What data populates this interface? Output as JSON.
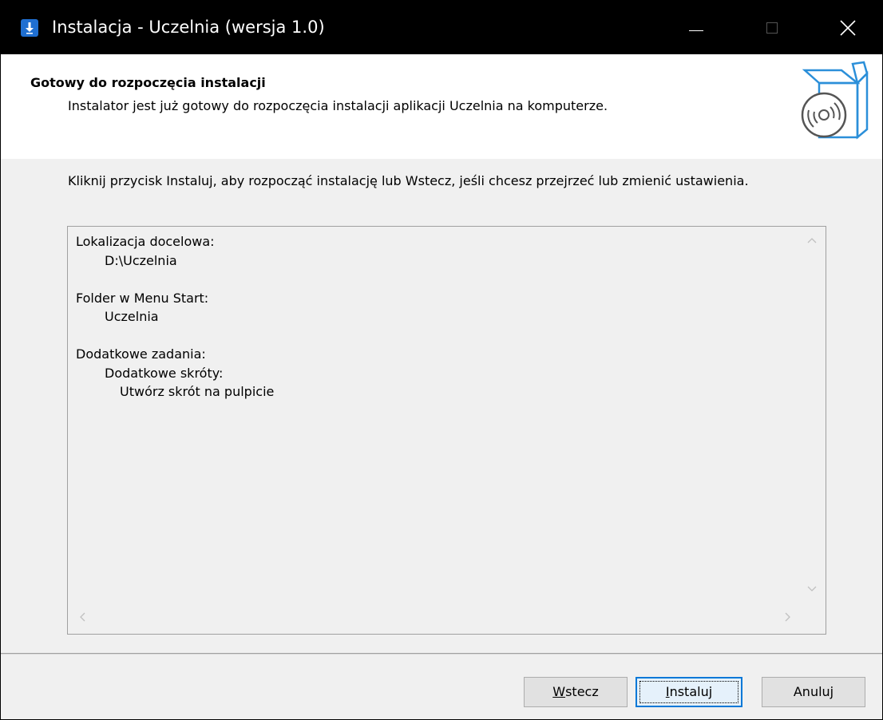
{
  "window": {
    "title": "Instalacja - Uczelnia (wersja 1.0)"
  },
  "header": {
    "title": "Gotowy do rozpoczęcia instalacji",
    "subtitle": "Instalator jest już gotowy do rozpoczęcia instalacji aplikacji Uczelnia na komputerze."
  },
  "content": {
    "description": "Kliknij przycisk Instaluj, aby rozpocząć instalację lub Wstecz, jeśli chcesz przejrzeć lub zmienić ustawienia.",
    "summary": {
      "dest_label": "Lokalizacja docelowa:",
      "dest_value": "D:\\Uczelnia",
      "start_menu_label": "Folder w Menu Start:",
      "start_menu_value": "Uczelnia",
      "tasks_label": "Dodatkowe zadania:",
      "tasks_group": "Dodatkowe skróty:",
      "tasks_item": "Utwórz skrót na pulpicie"
    }
  },
  "buttons": {
    "back_accel": "W",
    "back_rest": "stecz",
    "install_accel": "I",
    "install_rest": "nstaluj",
    "cancel": "Anuluj"
  },
  "colors": {
    "titlebar": "#000000",
    "accent": "#0078d7",
    "face": "#f0f0f0"
  },
  "icons": {
    "app": "download-arrow-icon",
    "header": "software-box-cd-icon"
  }
}
